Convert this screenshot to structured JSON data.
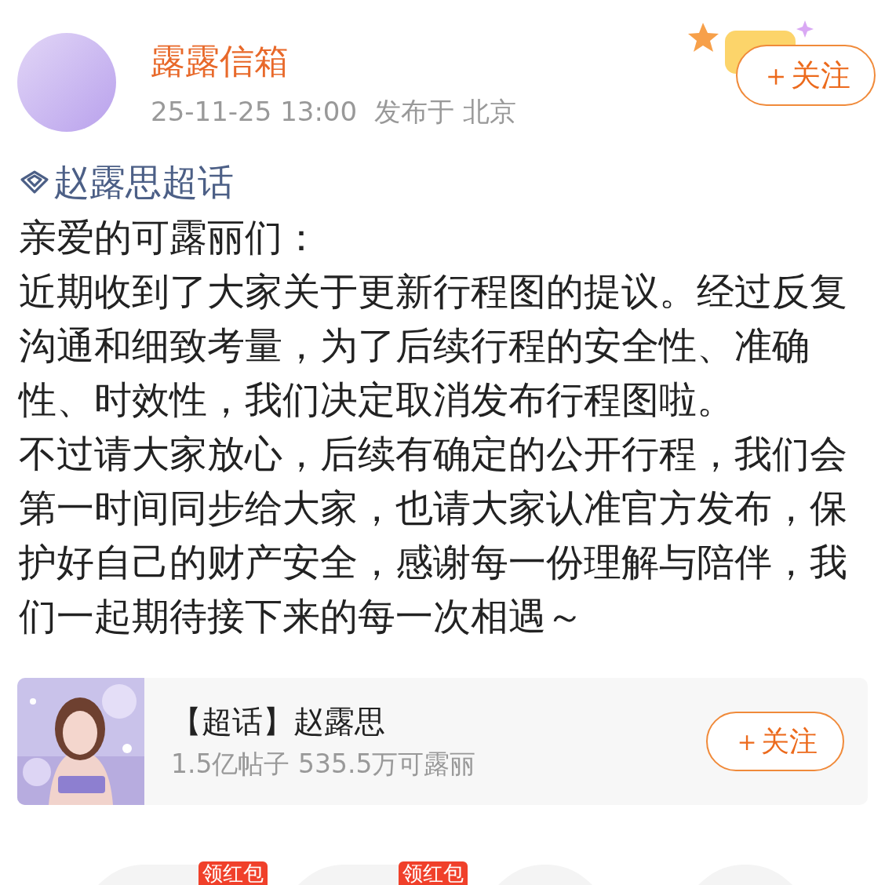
{
  "author": {
    "name": "露露信箱",
    "time": "25-11-25 13:00",
    "location": "发布于 北京"
  },
  "follow_button": {
    "label": "＋关注"
  },
  "topic_link": "赵露思超话",
  "post": {
    "paragraphs": [
      "亲爱的可露丽们：",
      "近期收到了大家关于更新行程图的提议。经过反复沟通和细致考量，为了后续行程的安全性、准确性、时效性，我们决定取消发布行程图啦。",
      "不过请大家放心，后续有确定的公开行程，我们会第一时间同步给大家，也请大家认准官方发布，保护好自己的财产安全，感谢每一份理解与陪伴，我们一起期待接下来的每一次相遇～"
    ]
  },
  "topic_card": {
    "title": "【超话】赵露思",
    "stats": "1.5亿帖子 535.5万可露丽",
    "follow_label": "＋关注"
  },
  "bottom_items": [
    {
      "kind": "badged",
      "badge": "领红包"
    },
    {
      "kind": "badged",
      "badge": "领红包"
    },
    {
      "kind": "plain"
    },
    {
      "kind": "plain"
    }
  ]
}
